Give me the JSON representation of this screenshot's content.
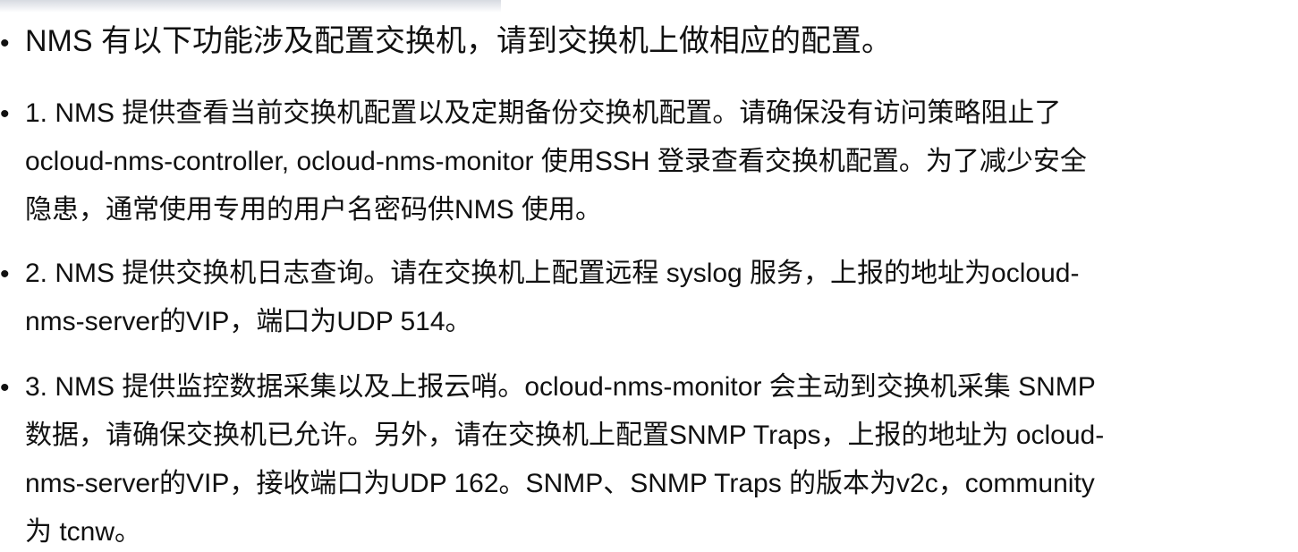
{
  "heading": {
    "bullet": "•",
    "text": "NMS 有以下功能涉及配置交换机，请到交换机上做相应的配置。"
  },
  "items": [
    {
      "bullet": "•",
      "lines": [
        "1.  NMS 提供查看当前交换机配置以及定期备份交换机配置。请确保没有访问策略阻止了",
        "ocloud-nms-controller, ocloud-nms-monitor 使用SSH 登录查看交换机配置。为了减少安全",
        "隐患，通常使用专用的用户名密码供NMS 使用。"
      ]
    },
    {
      "bullet": "•",
      "lines": [
        "2. NMS 提供交换机日志查询。请在交换机上配置远程 syslog 服务，上报的地址为ocloud-",
        "nms-server的VIP，端口为UDP 514。"
      ]
    },
    {
      "bullet": "•",
      "lines": [
        "3. NMS 提供监控数据采集以及上报云哨。ocloud-nms-monitor 会主动到交换机采集 SNMP",
        "数据，请确保交换机已允许。另外，请在交换机上配置SNMP Traps，上报的地址为 ocloud-",
        "nms-server的VIP，接收端口为UDP 162。SNMP、SNMP Traps 的版本为v2c，community",
        "为 tcnw。"
      ]
    }
  ]
}
